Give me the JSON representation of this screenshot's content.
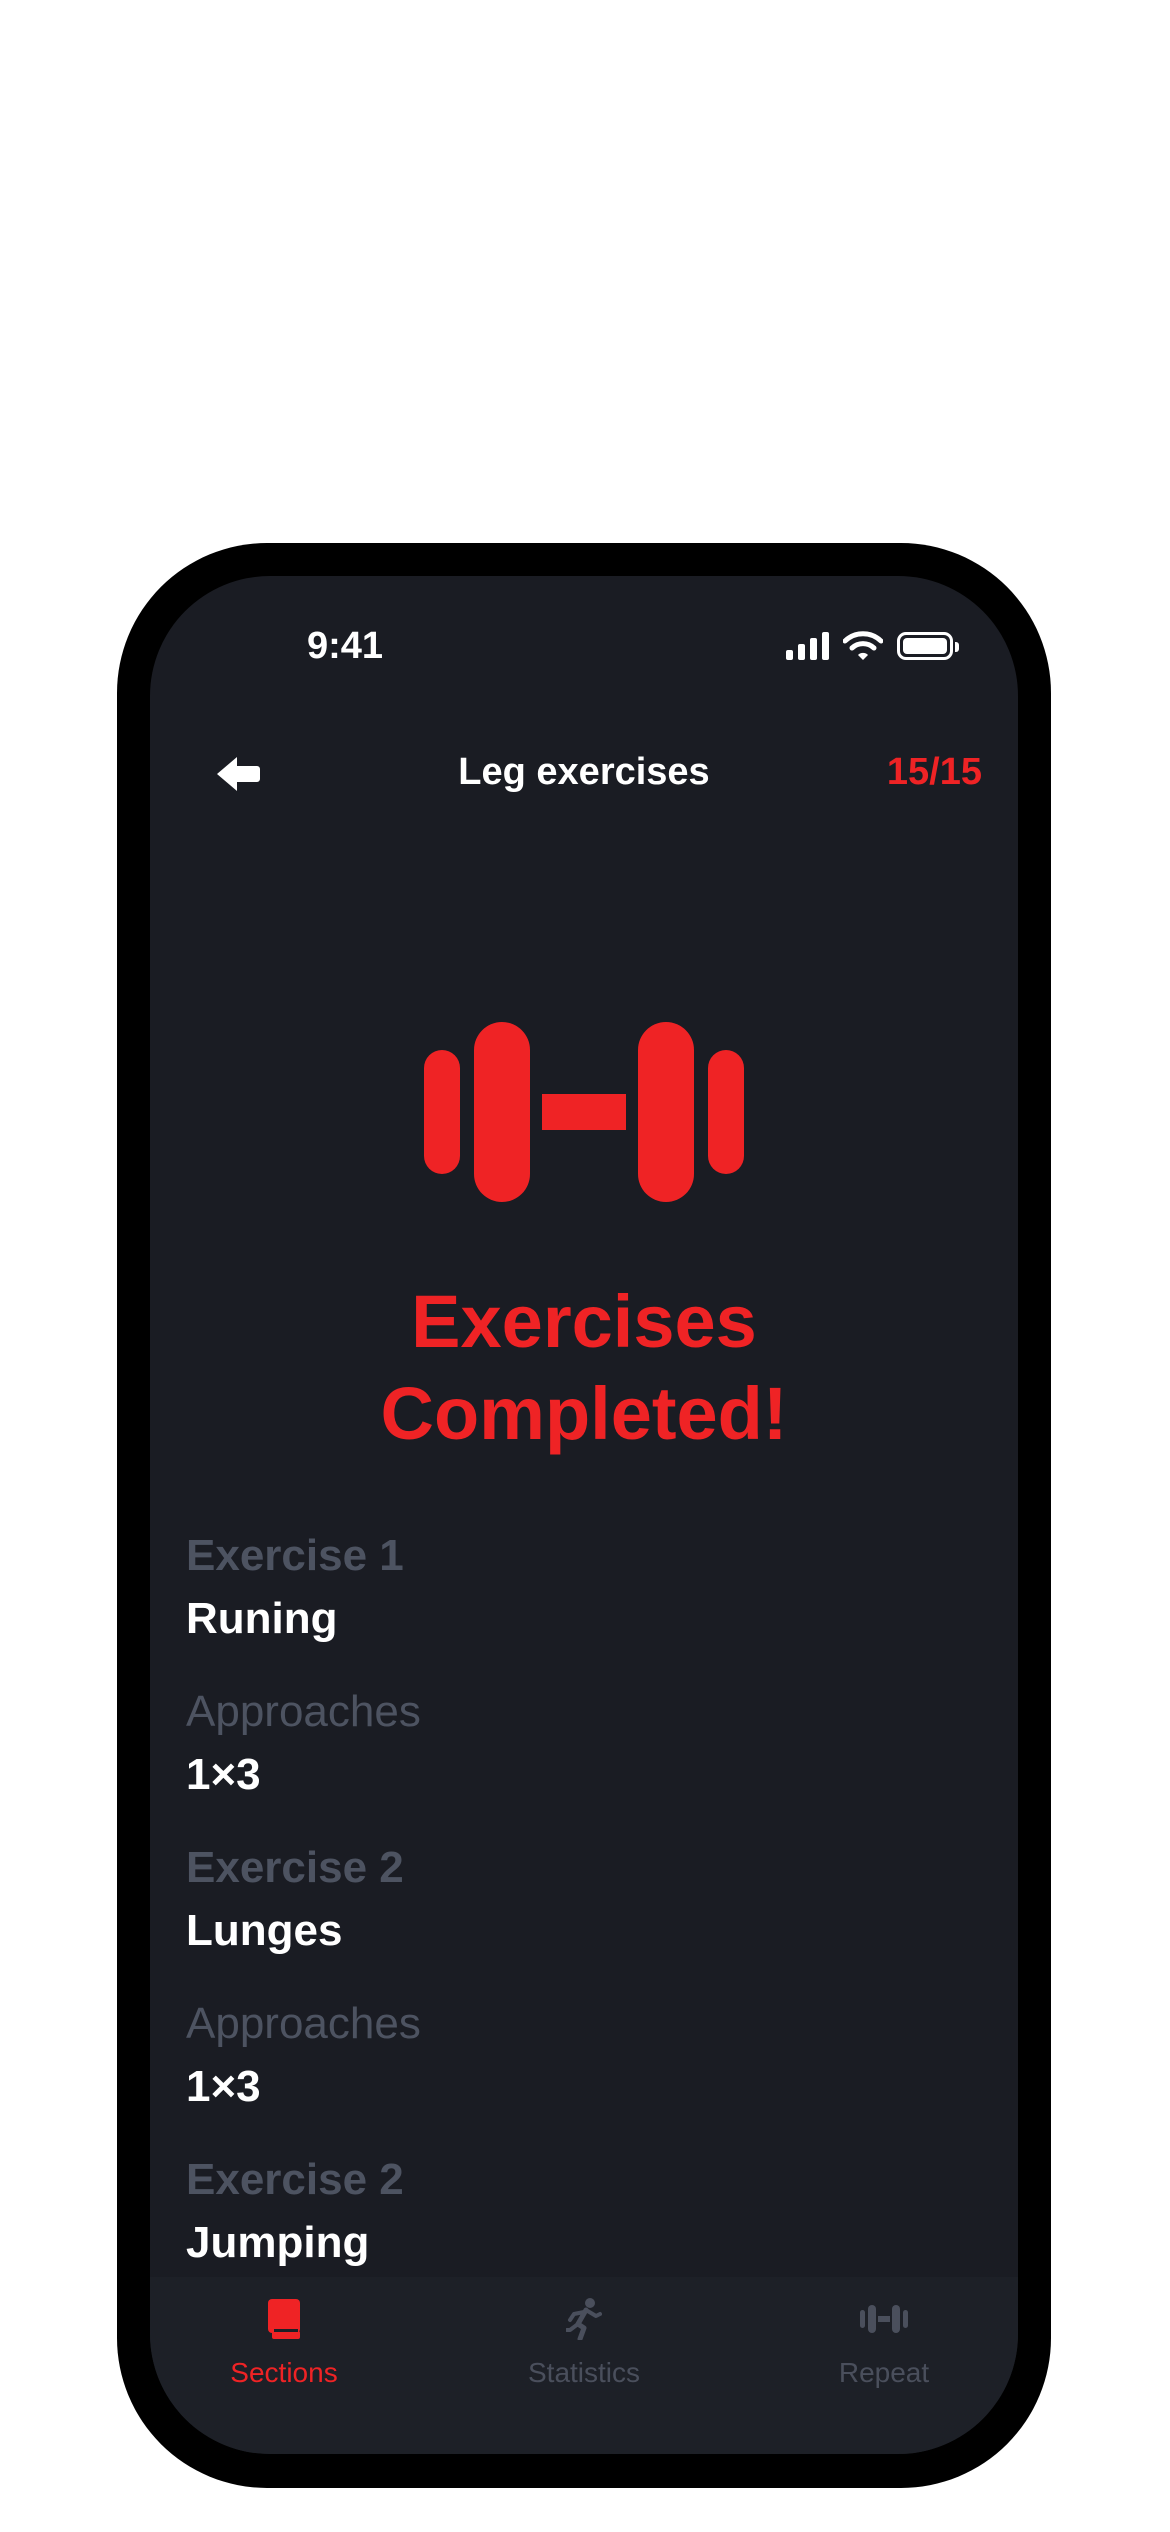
{
  "status_bar": {
    "time": "9:41"
  },
  "header": {
    "title": "Leg exercises",
    "progress": "15/15"
  },
  "completion": {
    "line1": "Exercises",
    "line2": "Completed!"
  },
  "exercises": [
    {
      "label": "Exercise 1",
      "name": "Runing",
      "approaches_label": "Approaches",
      "approaches": "1×3"
    },
    {
      "label": "Exercise 2",
      "name": "Lunges",
      "approaches_label": "Approaches",
      "approaches": "1×3"
    },
    {
      "label": "Exercise 2",
      "name": "Jumping"
    }
  ],
  "tab_bar": {
    "items": [
      {
        "label": "Sections",
        "icon": "book-icon",
        "active": true
      },
      {
        "label": "Statistics",
        "icon": "running-person-icon",
        "active": false
      },
      {
        "label": "Repeat",
        "icon": "dumbbell-icon",
        "active": false
      }
    ]
  },
  "colors": {
    "accent": "#ef2325",
    "background": "#1a1c23",
    "tab_bar": "#1d2027",
    "muted_label": "#4d5361",
    "inactive_tab": "#4a4f5c",
    "text": "#ffffff"
  }
}
